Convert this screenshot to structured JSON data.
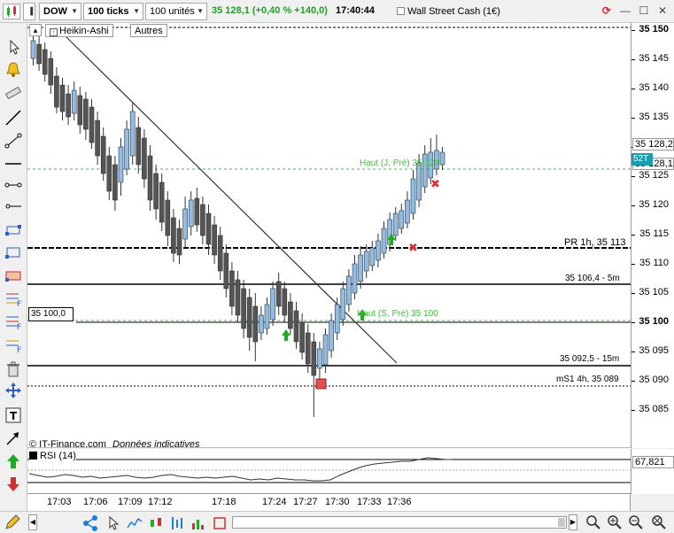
{
  "toolbar": {
    "symbol": "DOW",
    "tick_size": "100 ticks",
    "units": "100 unités",
    "quote_last": "35 128,1",
    "quote_change": "(+0,40 % +140,0)",
    "quote_time": "17:40:44",
    "instrument": "Wall Street Cash (1€)"
  },
  "chart": {
    "tab_heikin": "Heikin-Ashi",
    "tab_autres": "Autres",
    "copyright": "© IT-Finance.com",
    "disclaimer": "Données indicatives",
    "box_level": "35 100,0",
    "levels": {
      "haut_j": "Haut (J, Pré) 35 124",
      "pr1h": "PR 1h, 35 113",
      "s106": "35 106,4 - 5m",
      "haut_s": "Haut (S, Pré) 35 100",
      "s092": "35 092,5 - 15m",
      "ms1": "mS1 4h, 35 089"
    },
    "price_ticks": [
      "35 150",
      "35 145",
      "35 140",
      "35 135",
      "35 130",
      "35 125",
      "35 120",
      "35 115",
      "35 110",
      "35 105",
      "35 100",
      "35 095",
      "35 090",
      "35 085"
    ],
    "current_price_label": "35 128,2",
    "current_bid_label": "35 128,1",
    "badge": "52T",
    "time_ticks": [
      "17:03",
      "17:06",
      "17:09",
      "17:12",
      "17:18",
      "17:24",
      "17:27",
      "17:30",
      "17:33",
      "17:36"
    ]
  },
  "rsi": {
    "label": "RSI (14)",
    "value": "67,821",
    "level50": "50"
  },
  "colors": {
    "up": "#8fbde8",
    "down": "#555555",
    "green": "#22aa22",
    "red": "#e03030"
  }
}
